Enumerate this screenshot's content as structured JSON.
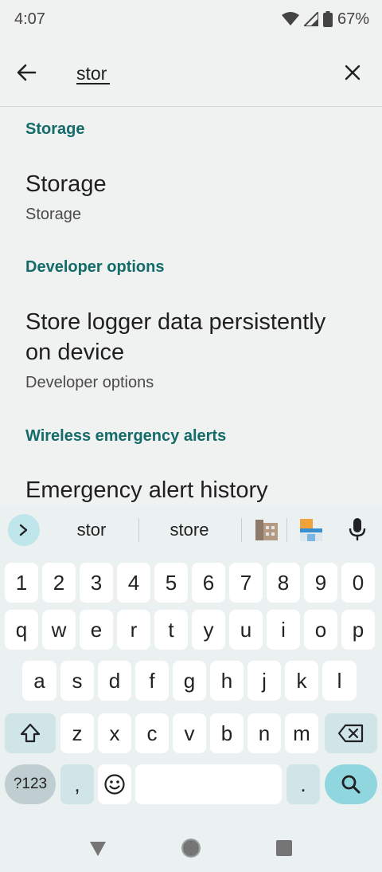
{
  "status": {
    "time": "4:07",
    "battery": "67%"
  },
  "search": {
    "query": "stor",
    "placeholder": ""
  },
  "results": [
    {
      "section": "Storage",
      "title_lines": [
        "Storage"
      ],
      "subtitle": "Storage"
    },
    {
      "section": "Developer options",
      "title_lines": [
        "Store logger data persistently",
        "on device"
      ],
      "subtitle": "Developer options"
    },
    {
      "section": "Wireless emergency alerts",
      "title_lines": [
        "Emergency alert history"
      ],
      "subtitle": ""
    }
  ],
  "keyboard": {
    "suggestions": [
      "stor",
      "store"
    ],
    "row_numbers": [
      "1",
      "2",
      "3",
      "4",
      "5",
      "6",
      "7",
      "8",
      "9",
      "0"
    ],
    "row1": [
      "q",
      "w",
      "e",
      "r",
      "t",
      "y",
      "u",
      "i",
      "o",
      "p"
    ],
    "row2": [
      "a",
      "s",
      "d",
      "f",
      "g",
      "h",
      "j",
      "k",
      "l"
    ],
    "row3": [
      "z",
      "x",
      "c",
      "v",
      "b",
      "n",
      "m"
    ],
    "symbols_key": "?123",
    "comma_key": ",",
    "period_key": "."
  },
  "colors": {
    "accent": "#136b6a",
    "key_action": "#8fd6de",
    "background": "#f0f2f1"
  },
  "icons": {
    "back": "arrow-left-icon",
    "clear": "close-icon",
    "wifi": "wifi-icon",
    "signal": "signal-icon",
    "battery": "battery-icon",
    "expand": "chevron-right-icon",
    "mic": "mic-icon",
    "shift": "shift-icon",
    "backspace": "backspace-icon",
    "emoji": "emoji-icon",
    "search": "search-icon"
  }
}
